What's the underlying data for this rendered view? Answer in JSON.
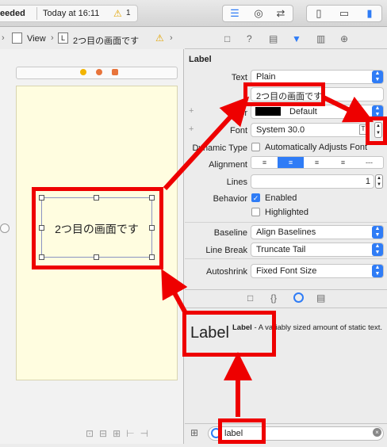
{
  "toolbar": {
    "status": "eeded",
    "time": "Today at 16:11",
    "warning_count": "1",
    "warning_icon": "⚠"
  },
  "jumpbar": {
    "view": "View",
    "label": "2つ目の画面です",
    "l_box": "L"
  },
  "canvas": {
    "label_text": "2つ目の画面です"
  },
  "inspector": {
    "section": "Label",
    "text_label": "Text",
    "text_value": "Plain",
    "text_content": "2つ目の画面です",
    "color_label": "Color",
    "color_value": "Default",
    "font_label": "Font",
    "font_value": "System 30.0",
    "dyntype_label": "Dynamic Type",
    "dyntype_value": "Automatically Adjusts Font",
    "alignment_label": "Alignment",
    "lines_label": "Lines",
    "lines_value": "1",
    "behavior_label": "Behavior",
    "enabled": "Enabled",
    "highlighted": "Highlighted",
    "baseline_label": "Baseline",
    "baseline_value": "Align Baselines",
    "linebreak_label": "Line Break",
    "linebreak_value": "Truncate Tail",
    "autoshrink_label": "Autoshrink",
    "autoshrink_value": "Fixed Font Size"
  },
  "library": {
    "item_big": "Label",
    "item_title": "Label",
    "item_desc": " - A variably sized amount of static text.",
    "filter_value": "label"
  },
  "colors": {
    "annotation": "#ee0000",
    "accent": "#2f7cf6"
  }
}
